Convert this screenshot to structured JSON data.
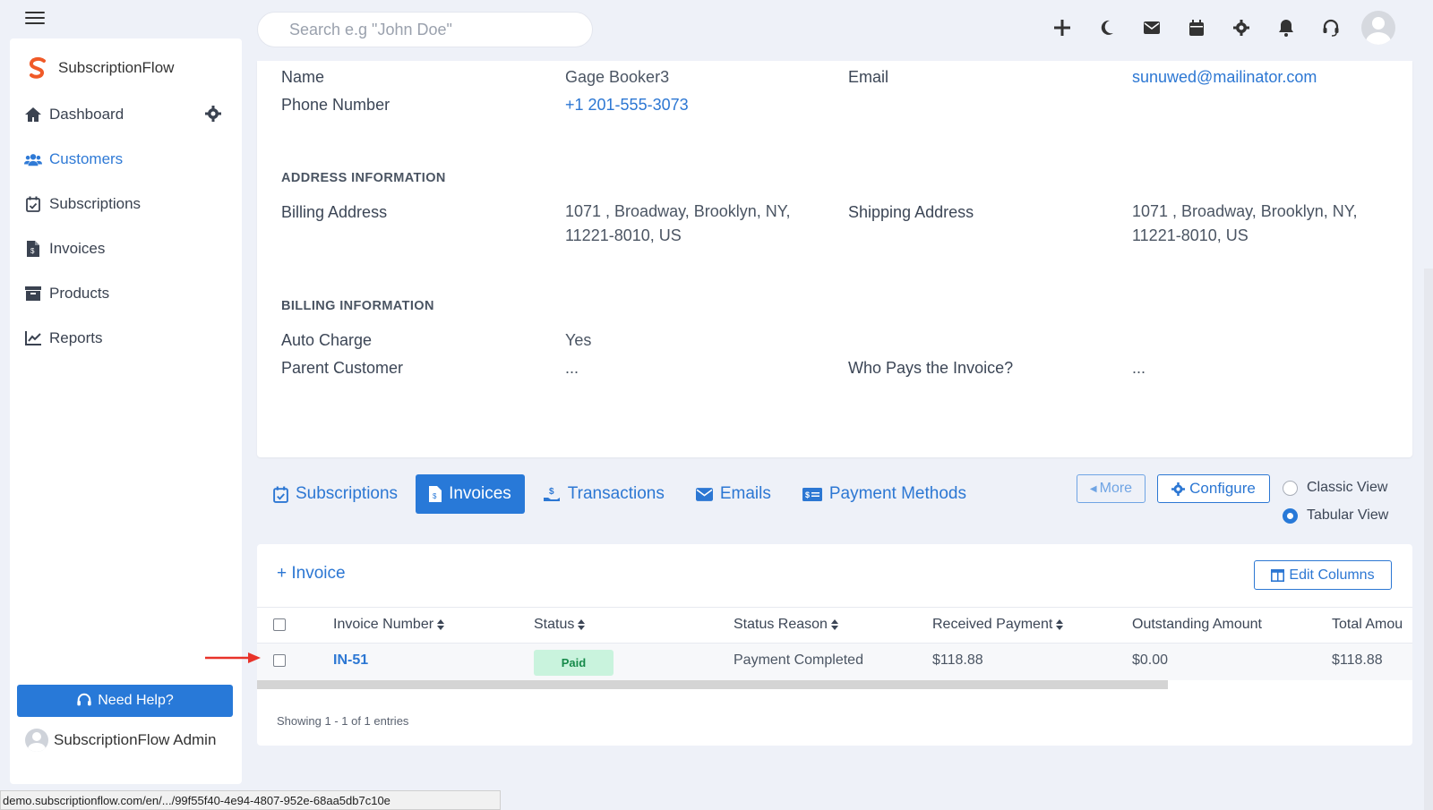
{
  "search": {
    "placeholder": "Search e.g \"John Doe\""
  },
  "topbar": {
    "icons": [
      "plus-icon",
      "moon-icon",
      "envelope-icon",
      "calendar-icon",
      "gear-icon",
      "bell-icon",
      "headset-icon",
      "avatar"
    ]
  },
  "sidebar": {
    "brand": "SubscriptionFlow",
    "items": [
      {
        "label": "Dashboard",
        "icon": "home-icon"
      },
      {
        "label": "Customers",
        "icon": "users-icon",
        "active": true
      },
      {
        "label": "Subscriptions",
        "icon": "calendar-check-icon"
      },
      {
        "label": "Invoices",
        "icon": "file-invoice-icon"
      },
      {
        "label": "Products",
        "icon": "archive-box-icon"
      },
      {
        "label": "Reports",
        "icon": "chart-line-icon"
      }
    ],
    "help_label": "Need Help?",
    "admin_name": "SubscriptionFlow Admin"
  },
  "details": {
    "name_label": "Name",
    "name_value": "Gage Booker3",
    "email_label": "Email",
    "email_value": "sunuwed@mailinator.com",
    "phone_label": "Phone Number",
    "phone_value": "+1 201-555-3073",
    "address_heading": "ADDRESS INFORMATION",
    "billing_address_label": "Billing Address",
    "billing_address_line1": "1071 , Broadway, Brooklyn, NY,",
    "billing_address_line2": "11221-8010, US",
    "shipping_address_label": "Shipping Address",
    "shipping_address_line1": "1071 , Broadway, Brooklyn, NY,",
    "shipping_address_line2": "11221-8010, US",
    "billing_heading": "BILLING INFORMATION",
    "auto_charge_label": "Auto Charge",
    "auto_charge_value": "Yes",
    "parent_customer_label": "Parent Customer",
    "parent_customer_value": "...",
    "who_pays_label": "Who Pays the Invoice?",
    "who_pays_value": "..."
  },
  "tabs": [
    {
      "label": "Subscriptions",
      "icon": "calendar-check-icon"
    },
    {
      "label": "Invoices",
      "icon": "file-invoice-icon",
      "active": true
    },
    {
      "label": "Transactions",
      "icon": "hand-dollar-icon"
    },
    {
      "label": "Emails",
      "icon": "envelope-icon"
    },
    {
      "label": "Payment Methods",
      "icon": "money-bill-icon"
    }
  ],
  "toolbar": {
    "more_label": "More",
    "configure_label": "Configure",
    "classic_view_label": "Classic View",
    "tabular_view_label": "Tabular View",
    "selected_view": "Tabular View"
  },
  "invoices": {
    "add_label": "+ Invoice",
    "edit_columns_label": "Edit Columns",
    "columns": [
      "Invoice Number",
      "Status",
      "Status Reason",
      "Received Payment",
      "Outstanding Amount",
      "Total Amou"
    ],
    "rows": [
      {
        "invoice_number": "IN-51",
        "status": "Paid",
        "status_reason": "Payment Completed",
        "received_payment": "$118.88",
        "outstanding_amount": "$0.00",
        "total_amount": "$118.88"
      }
    ],
    "showing": "Showing 1 - 1 of 1 entries"
  },
  "statusbar": {
    "url": "demo.subscriptionflow.com/en/.../99f55f40-4e94-4807-952e-68aa5db7c10e"
  },
  "colors": {
    "accent": "#2879d8",
    "link": "#2c77d3",
    "paid_bg": "#c9f3dd",
    "paid_text": "#168a4a",
    "annotation": "#e8332a"
  }
}
